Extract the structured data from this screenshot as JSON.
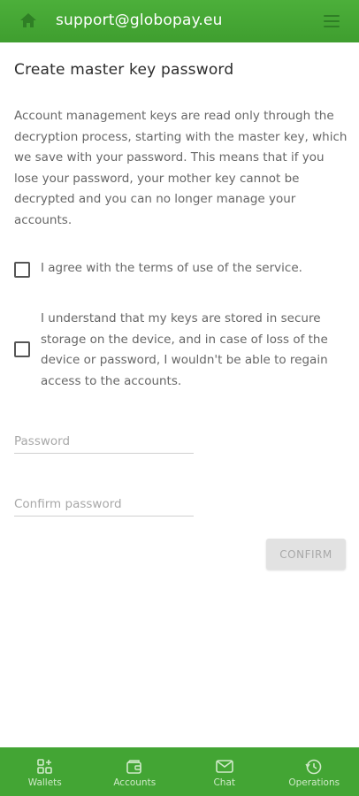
{
  "header": {
    "title": "support@globopay.eu",
    "home_icon": "home-icon",
    "menu_icon": "hamburger-menu-icon",
    "bg_color": "#43a534"
  },
  "main": {
    "title": "Create master key password",
    "description": "Account management keys are read only through the decryption process, starting with the master key, which we save with your password. This means that if you lose your password, your mother key cannot be decrypted and you can no longer manage your accounts.",
    "checkbox_terms": {
      "label": "I agree with the terms of use of the service.",
      "checked": false
    },
    "checkbox_storage": {
      "label": "I understand that my keys are stored in secure storage on the device, and in case of loss of the device or password, I wouldn't be able to regain access to the accounts.",
      "checked": false
    },
    "password": {
      "placeholder": "Password",
      "value": ""
    },
    "confirm_password": {
      "placeholder": "Confirm password",
      "value": ""
    },
    "confirm_button": "CONFIRM"
  },
  "nav": {
    "items": [
      {
        "label": "Wallets",
        "icon": "wallets-grid-icon"
      },
      {
        "label": "Accounts",
        "icon": "accounts-wallet-icon"
      },
      {
        "label": "Chat",
        "icon": "chat-envelope-icon"
      },
      {
        "label": "Operations",
        "icon": "operations-history-icon"
      }
    ]
  }
}
